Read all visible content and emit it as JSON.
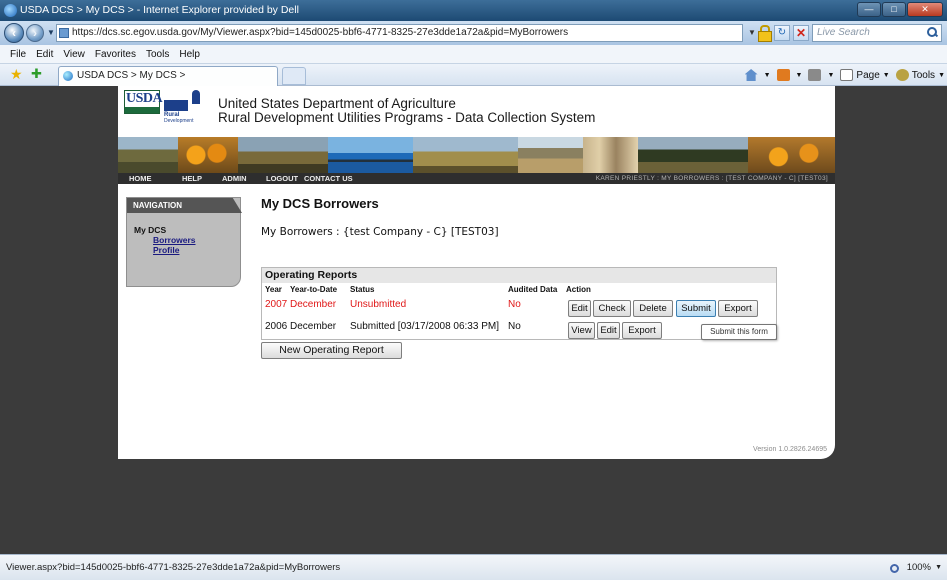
{
  "window": {
    "title": "USDA DCS > My DCS > - Internet Explorer provided by Dell",
    "min_glyph": "—",
    "max_glyph": "□",
    "close_glyph": "✕"
  },
  "browser": {
    "url": "https://dcs.sc.egov.usda.gov/My/Viewer.aspx?bid=145d0025-bbf6-4771-8325-27e3dde1a72a&pid=MyBorrowers",
    "search_placeholder": "Live Search",
    "menu": [
      "File",
      "Edit",
      "View",
      "Favorites",
      "Tools",
      "Help"
    ],
    "tab_title": "USDA DCS > My DCS >",
    "commands": {
      "page": "Page",
      "tools": "Tools"
    },
    "status_text": "Viewer.aspx?bid=145d0025-bbf6-4771-8325-27e3dde1a72a&pid=MyBorrowers",
    "zoom": "100%"
  },
  "site": {
    "usda_logo_text": "USDA",
    "rd_logo_line1": "Rural",
    "rd_logo_line2": "Development",
    "header_line1": "United States Department of Agriculture",
    "header_line2": "Rural Development Utilities Programs - Data Collection System",
    "topnav": [
      "HOME",
      "HELP",
      "ADMIN",
      "LOGOUT",
      "CONTACT US"
    ],
    "breadcrumb": "KAREN PRIESTLY : MY BORROWERS : [TEST COMPANY - C] [TEST03]",
    "version": "Version 1.0.2826.24695"
  },
  "navigation": {
    "header": "NAVIGATION",
    "section": "My DCS",
    "links": [
      "Borrowers",
      "Profile"
    ]
  },
  "main": {
    "title": "My DCS Borrowers",
    "subline": "My Borrowers : {test Company - C} [TEST03]"
  },
  "reports": {
    "title": "Operating Reports",
    "columns": [
      "Year",
      "Year-to-Date",
      "Status",
      "Audited Data",
      "Action"
    ],
    "rows": [
      {
        "year": "2007",
        "ytd": "December",
        "status": "Unsubmitted",
        "audited": "No",
        "actions": [
          "Edit",
          "Check",
          "Delete",
          "Submit",
          "Export"
        ]
      },
      {
        "year": "2006",
        "ytd": "December",
        "status": "Submitted [03/17/2008 06:33 PM]",
        "audited": "No",
        "actions": [
          "View",
          "Edit",
          "Export"
        ]
      }
    ],
    "tooltip": "Submit this form",
    "new_button": "New Operating Report"
  },
  "colors": {
    "accent_red": "#e01818",
    "nav_dark": "#2e2e2e",
    "page_bg": "#3b3b3b"
  }
}
